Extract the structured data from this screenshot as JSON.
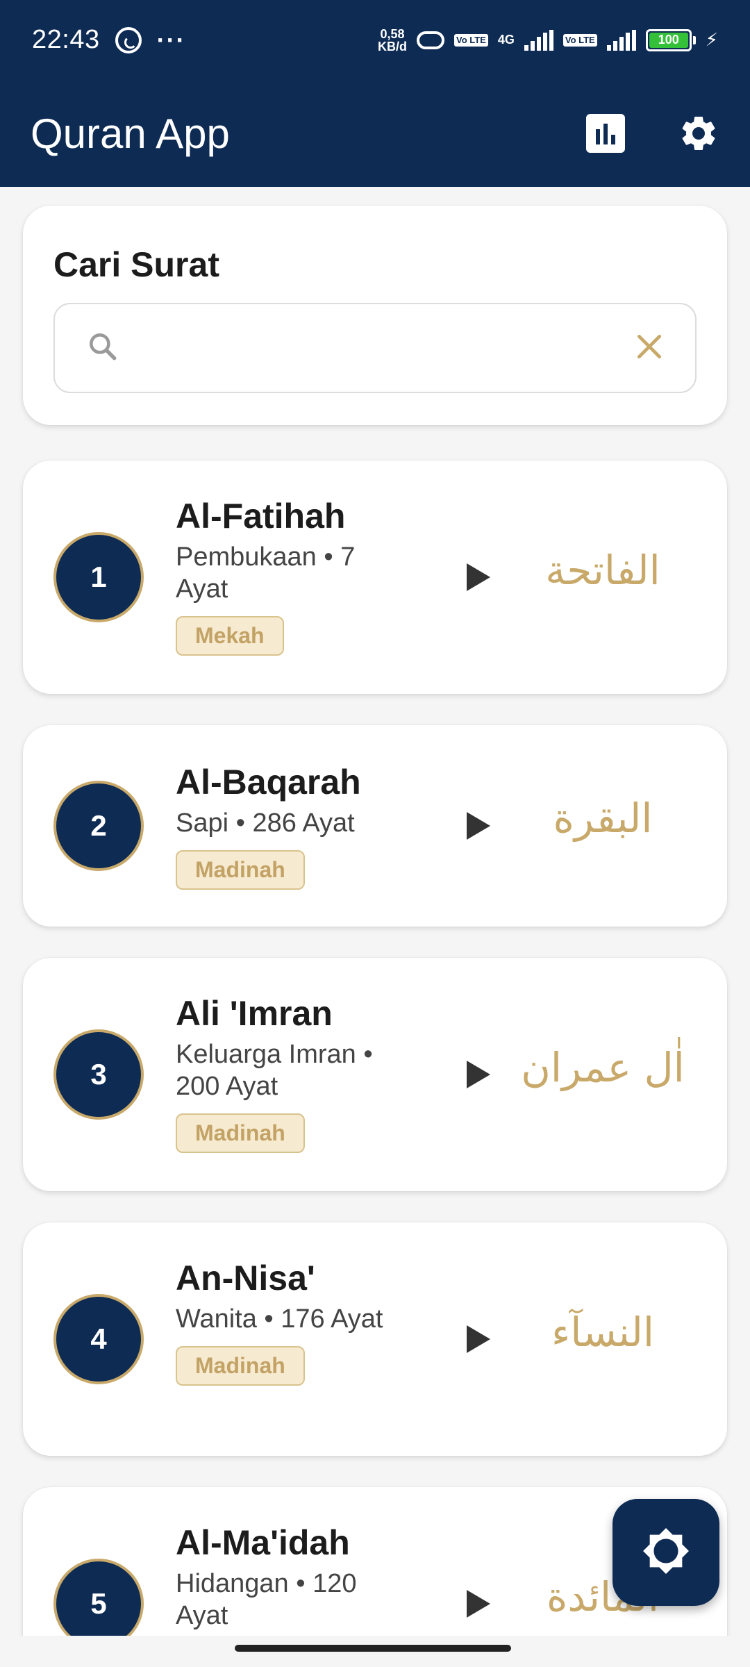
{
  "status_bar": {
    "time": "22:43",
    "more": "···",
    "speed_value": "0,58",
    "speed_unit": "KB/d",
    "volte1": "Vo LTE",
    "network": "4G",
    "volte2": "Vo LTE",
    "battery": "100"
  },
  "app_bar": {
    "title": "Quran App",
    "icons": [
      "bar-chart-icon",
      "gear-icon"
    ]
  },
  "search": {
    "label": "Cari Surat",
    "value": "",
    "placeholder": "",
    "icons": [
      "search-icon",
      "clear-icon"
    ]
  },
  "surahs": [
    {
      "number": "1",
      "name": "Al-Fatihah",
      "meta": "Pembukaan • 7 Ayat",
      "place": "Mekah",
      "arabic": "الفاتحة"
    },
    {
      "number": "2",
      "name": "Al-Baqarah",
      "meta": "Sapi • 286 Ayat",
      "place": "Madinah",
      "arabic": "البقرة"
    },
    {
      "number": "3",
      "name": "Ali 'Imran",
      "meta": "Keluarga Imran • 200 Ayat",
      "place": "Madinah",
      "arabic": "اٰل عمران"
    },
    {
      "number": "4",
      "name": "An-Nisa'",
      "meta": "Wanita • 176 Ayat",
      "place": "Madinah",
      "arabic": "النسآء"
    },
    {
      "number": "5",
      "name": "Al-Ma'idah",
      "meta": "Hidangan • 120 Ayat",
      "place": "",
      "arabic": "المائدة"
    }
  ],
  "fab": {
    "icon": "brightness-icon"
  },
  "colors": {
    "primary": "#0e2b54",
    "accent_gold": "#c8a96a",
    "badge_bg": "#f6ead0"
  }
}
